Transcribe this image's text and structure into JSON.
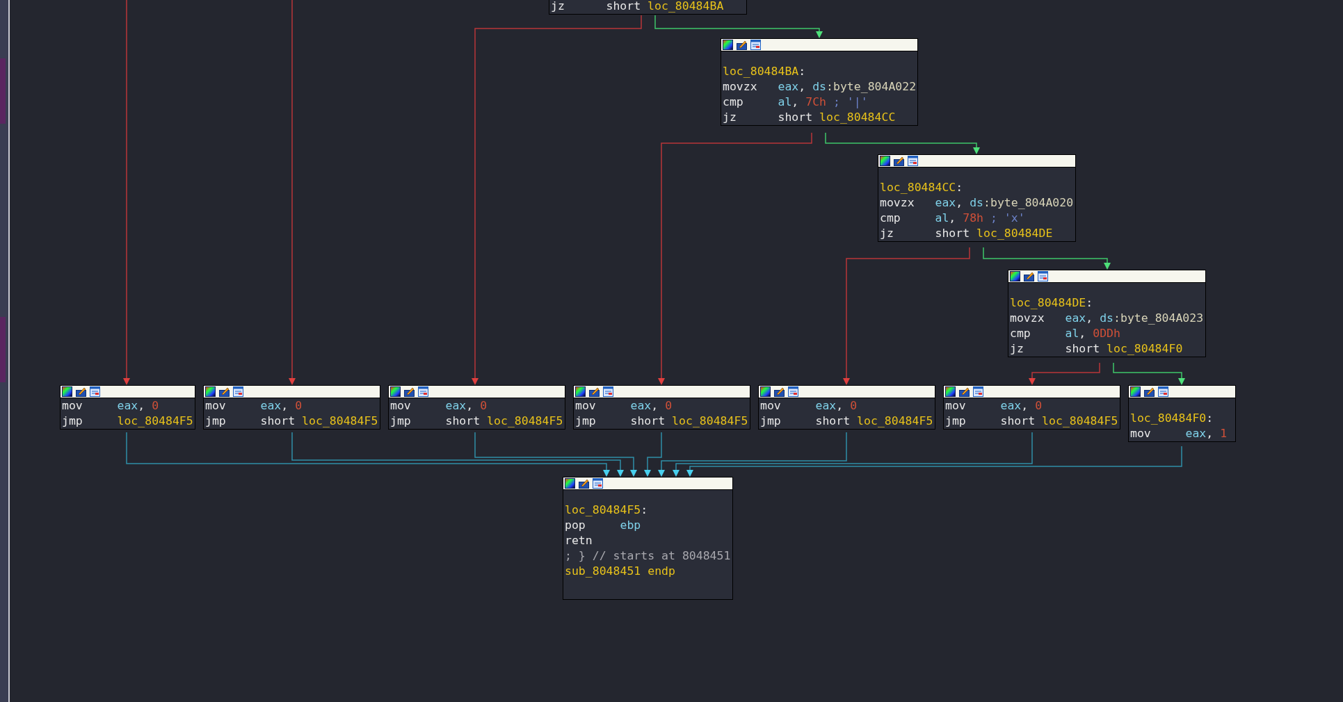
{
  "graph": {
    "nodes": [
      {
        "lines": [
          [
            {
              "text": "jz",
              "kind": "op"
            },
            {
              "text": "short ",
              "kind": "plain"
            },
            {
              "text": "loc_80484BA",
              "kind": "sym"
            }
          ]
        ]
      },
      {
        "lines": [
          [
            {
              "text": "loc_80484BA",
              "kind": "label"
            },
            {
              "text": ":",
              "kind": "plain"
            }
          ],
          [
            {
              "text": "movzx",
              "kind": "op"
            },
            {
              "text": "eax",
              "kind": "reg"
            },
            {
              "text": ", ",
              "kind": "plain"
            },
            {
              "text": "ds",
              "kind": "reg"
            },
            {
              "text": ":byte_804A022",
              "kind": "data"
            }
          ],
          [
            {
              "text": "cmp",
              "kind": "op"
            },
            {
              "text": "al",
              "kind": "reg"
            },
            {
              "text": ", ",
              "kind": "plain"
            },
            {
              "text": "7Ch",
              "kind": "num"
            },
            {
              "text": " ; '|'",
              "kind": "cmt"
            }
          ],
          [
            {
              "text": "jz",
              "kind": "op"
            },
            {
              "text": "short ",
              "kind": "plain"
            },
            {
              "text": "loc_80484CC",
              "kind": "sym"
            }
          ]
        ]
      },
      {
        "lines": [
          [
            {
              "text": "loc_80484CC",
              "kind": "label"
            },
            {
              "text": ":",
              "kind": "plain"
            }
          ],
          [
            {
              "text": "movzx",
              "kind": "op"
            },
            {
              "text": "eax",
              "kind": "reg"
            },
            {
              "text": ", ",
              "kind": "plain"
            },
            {
              "text": "ds",
              "kind": "reg"
            },
            {
              "text": ":byte_804A020",
              "kind": "data"
            }
          ],
          [
            {
              "text": "cmp",
              "kind": "op"
            },
            {
              "text": "al",
              "kind": "reg"
            },
            {
              "text": ", ",
              "kind": "plain"
            },
            {
              "text": "78h",
              "kind": "num"
            },
            {
              "text": " ; 'x'",
              "kind": "cmt"
            }
          ],
          [
            {
              "text": "jz",
              "kind": "op"
            },
            {
              "text": "short ",
              "kind": "plain"
            },
            {
              "text": "loc_80484DE",
              "kind": "sym"
            }
          ]
        ]
      },
      {
        "lines": [
          [
            {
              "text": "loc_80484DE",
              "kind": "label"
            },
            {
              "text": ":",
              "kind": "plain"
            }
          ],
          [
            {
              "text": "movzx",
              "kind": "op"
            },
            {
              "text": "eax",
              "kind": "reg"
            },
            {
              "text": ", ",
              "kind": "plain"
            },
            {
              "text": "ds",
              "kind": "reg"
            },
            {
              "text": ":byte_804A023",
              "kind": "data"
            }
          ],
          [
            {
              "text": "cmp",
              "kind": "op"
            },
            {
              "text": "al",
              "kind": "reg"
            },
            {
              "text": ", ",
              "kind": "plain"
            },
            {
              "text": "0DDh",
              "kind": "num"
            }
          ],
          [
            {
              "text": "jz",
              "kind": "op"
            },
            {
              "text": "short ",
              "kind": "plain"
            },
            {
              "text": "loc_80484F0",
              "kind": "sym"
            }
          ]
        ]
      },
      {
        "lines": [
          [
            {
              "text": "mov",
              "kind": "op"
            },
            {
              "text": "eax",
              "kind": "reg"
            },
            {
              "text": ", ",
              "kind": "plain"
            },
            {
              "text": "0",
              "kind": "num"
            }
          ],
          [
            {
              "text": "jmp",
              "kind": "op"
            },
            {
              "text": "loc_80484F5",
              "kind": "sym"
            }
          ]
        ]
      },
      {
        "lines": [
          [
            {
              "text": "mov",
              "kind": "op"
            },
            {
              "text": "eax",
              "kind": "reg"
            },
            {
              "text": ", ",
              "kind": "plain"
            },
            {
              "text": "0",
              "kind": "num"
            }
          ],
          [
            {
              "text": "jmp",
              "kind": "op"
            },
            {
              "text": "short ",
              "kind": "plain"
            },
            {
              "text": "loc_80484F5",
              "kind": "sym"
            }
          ]
        ]
      },
      {
        "lines": [
          [
            {
              "text": "mov",
              "kind": "op"
            },
            {
              "text": "eax",
              "kind": "reg"
            },
            {
              "text": ", ",
              "kind": "plain"
            },
            {
              "text": "0",
              "kind": "num"
            }
          ],
          [
            {
              "text": "jmp",
              "kind": "op"
            },
            {
              "text": "short ",
              "kind": "plain"
            },
            {
              "text": "loc_80484F5",
              "kind": "sym"
            }
          ]
        ]
      },
      {
        "lines": [
          [
            {
              "text": "mov",
              "kind": "op"
            },
            {
              "text": "eax",
              "kind": "reg"
            },
            {
              "text": ", ",
              "kind": "plain"
            },
            {
              "text": "0",
              "kind": "num"
            }
          ],
          [
            {
              "text": "jmp",
              "kind": "op"
            },
            {
              "text": "short ",
              "kind": "plain"
            },
            {
              "text": "loc_80484F5",
              "kind": "sym"
            }
          ]
        ]
      },
      {
        "lines": [
          [
            {
              "text": "mov",
              "kind": "op"
            },
            {
              "text": "eax",
              "kind": "reg"
            },
            {
              "text": ", ",
              "kind": "plain"
            },
            {
              "text": "0",
              "kind": "num"
            }
          ],
          [
            {
              "text": "jmp",
              "kind": "op"
            },
            {
              "text": "short ",
              "kind": "plain"
            },
            {
              "text": "loc_80484F5",
              "kind": "sym"
            }
          ]
        ]
      },
      {
        "lines": [
          [
            {
              "text": "mov",
              "kind": "op"
            },
            {
              "text": "eax",
              "kind": "reg"
            },
            {
              "text": ", ",
              "kind": "plain"
            },
            {
              "text": "0",
              "kind": "num"
            }
          ],
          [
            {
              "text": "jmp",
              "kind": "op"
            },
            {
              "text": "short ",
              "kind": "plain"
            },
            {
              "text": "loc_80484F5",
              "kind": "sym"
            }
          ]
        ]
      },
      {
        "lines": [
          [
            {
              "text": "loc_80484F0",
              "kind": "label"
            },
            {
              "text": ":",
              "kind": "plain"
            }
          ],
          [
            {
              "text": "mov",
              "kind": "op"
            },
            {
              "text": "eax",
              "kind": "reg"
            },
            {
              "text": ", ",
              "kind": "plain"
            },
            {
              "text": "1",
              "kind": "num"
            }
          ]
        ]
      },
      {
        "lines": [
          [
            {
              "text": "loc_80484F5",
              "kind": "label"
            },
            {
              "text": ":",
              "kind": "plain"
            }
          ],
          [
            {
              "text": "pop",
              "kind": "op"
            },
            {
              "text": "ebp",
              "kind": "reg"
            }
          ],
          [
            {
              "text": "retn",
              "kind": "op"
            }
          ],
          [
            {
              "text": "; } // starts at 8048451",
              "kind": "cmt2"
            }
          ],
          [
            {
              "text": "sub_8048451 endp",
              "kind": "sym"
            }
          ]
        ]
      }
    ]
  }
}
